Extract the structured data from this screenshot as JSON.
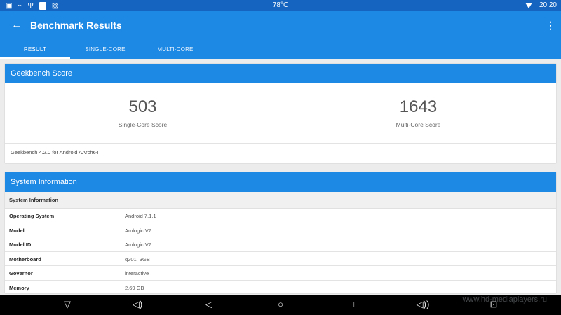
{
  "status_bar": {
    "temperature": "78°C",
    "time": "20:20"
  },
  "app_bar": {
    "title": "Benchmark Results"
  },
  "tabs": [
    {
      "label": "RESULT",
      "selected": true
    },
    {
      "label": "SINGLE-CORE",
      "selected": false
    },
    {
      "label": "MULTI-CORE",
      "selected": false
    }
  ],
  "geekbench_card": {
    "title": "Geekbench Score",
    "single_core": {
      "value": "503",
      "label": "Single-Core Score"
    },
    "multi_core": {
      "value": "1643",
      "label": "Multi-Core Score"
    },
    "version": "Geekbench 4.2.0 for Android AArch64"
  },
  "system_card": {
    "title": "System Information",
    "subheader": "System Information",
    "rows": [
      {
        "key": "Operating System",
        "value": "Android 7.1.1"
      },
      {
        "key": "Model",
        "value": "Amlogic V7"
      },
      {
        "key": "Model ID",
        "value": "Amlogic V7"
      },
      {
        "key": "Motherboard",
        "value": "q201_3GB"
      },
      {
        "key": "Governor",
        "value": "interactive"
      },
      {
        "key": "Memory",
        "value": "2.69 GB"
      }
    ]
  },
  "watermark": "www.hd-mediaplayers.ru",
  "colors": {
    "status_bar": "#1565c0",
    "app_bar": "#1e88e5",
    "card_header": "#1e88e5",
    "background": "#ececec",
    "nav_bar": "#000000"
  },
  "icons": {
    "back": "arrow-left-icon",
    "overflow": "more-vert-icon",
    "wifi": "wifi-icon"
  }
}
